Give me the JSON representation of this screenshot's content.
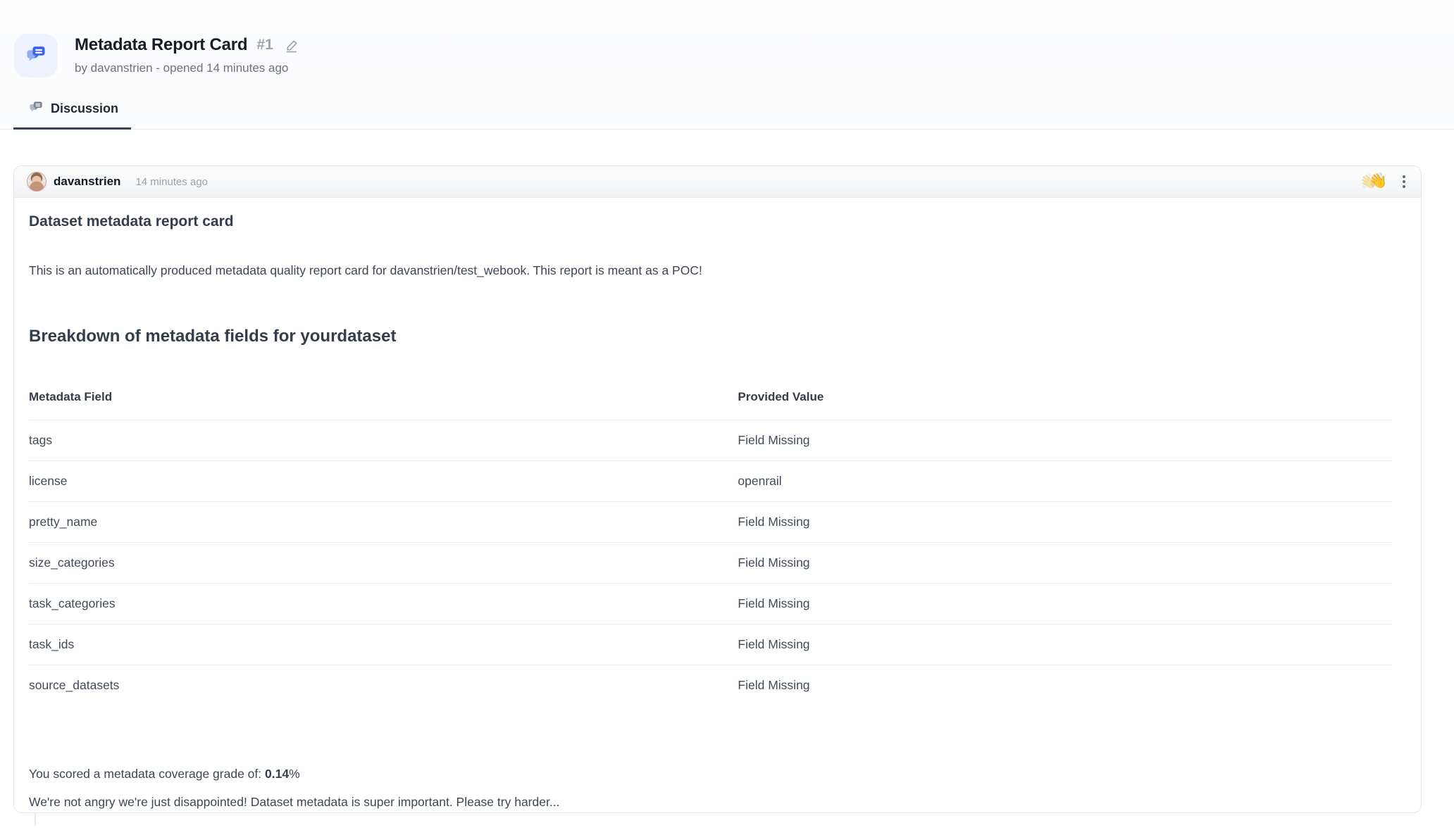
{
  "page": {
    "title": "Metadata Report Card",
    "issue_number": "#1",
    "byline": "by davanstrien - opened 14 minutes ago",
    "tab_label": "Discussion"
  },
  "comment": {
    "author": "davanstrien",
    "timestamp": "14 minutes ago",
    "reaction_emoji": "👋",
    "heading": "Dataset metadata report card",
    "intro": "This is an automatically produced metadata quality report card for davanstrien/test_webook. This report is meant as a POC!",
    "breakdown_heading": "Breakdown of metadata fields for yourdataset",
    "table": {
      "columns": [
        "Metadata Field",
        "Provided Value"
      ],
      "rows": [
        [
          "tags",
          "Field Missing"
        ],
        [
          "license",
          "openrail"
        ],
        [
          "pretty_name",
          "Field Missing"
        ],
        [
          "size_categories",
          "Field Missing"
        ],
        [
          "task_categories",
          "Field Missing"
        ],
        [
          "task_ids",
          "Field Missing"
        ],
        [
          "source_datasets",
          "Field Missing"
        ]
      ]
    },
    "score_prefix": "You scored a metadata coverage grade of: ",
    "score_value": "0.14",
    "score_suffix": "%",
    "closing_remark": "We're not angry we're just disappointed! Dataset metadata is super important. Please try harder..."
  },
  "colors": {
    "accent_blue": "#3d63e8",
    "accent_blue_light": "#93aef5",
    "badge_bg": "#eef2fc",
    "tab_underline": "#394252",
    "card_border": "#e3e6ea",
    "muted_gray": "#9ba3b0"
  }
}
